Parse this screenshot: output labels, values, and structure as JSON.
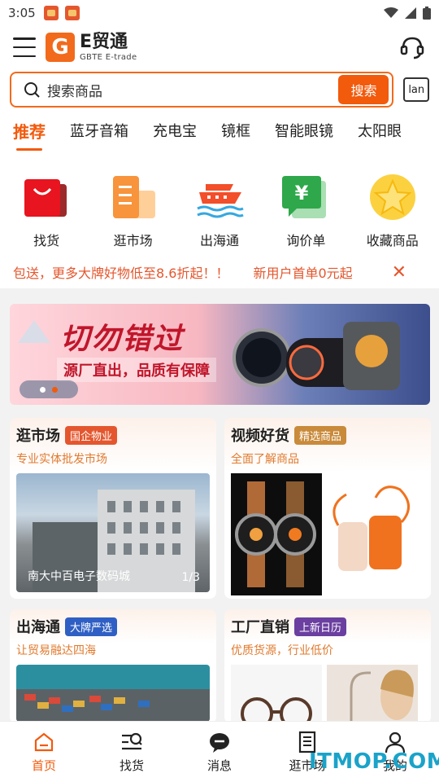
{
  "status": {
    "time": "3:05"
  },
  "header": {
    "logo_mark": "G",
    "logo_title": "E贸通",
    "logo_sub": "GBTE E-trade"
  },
  "search": {
    "placeholder": "搜索商品",
    "button": "搜索",
    "lang_button": "lan"
  },
  "tabs": [
    "推荐",
    "蓝牙音箱",
    "充电宝",
    "镜框",
    "智能眼镜",
    "太阳眼"
  ],
  "quick": [
    {
      "label": "找货",
      "icon": "shopping-bag-icon"
    },
    {
      "label": "逛市场",
      "icon": "building-icon"
    },
    {
      "label": "出海通",
      "icon": "ship-icon"
    },
    {
      "label": "询价单",
      "icon": "yen-quote-icon"
    },
    {
      "label": "收藏商品",
      "icon": "star-icon"
    }
  ],
  "ticker": {
    "text1": "包送，更多大牌好物低至8.6折起！！",
    "text2": "新用户首单0元起"
  },
  "banner": {
    "title": "切勿错过",
    "subtitle": "源厂直出，品质有保障"
  },
  "cards": [
    {
      "title": "逛市场",
      "badge": "国企物业",
      "badge_color": "#e4572e",
      "subtitle": "专业实体批发市场",
      "caption": "南大中百电子数码城",
      "page": "1/3"
    },
    {
      "title": "视频好货",
      "badge": "精选商品",
      "badge_color": "#c98a3a",
      "subtitle": "全面了解商品"
    },
    {
      "title": "出海通",
      "badge": "大牌严选",
      "badge_color": "#2f5fc4",
      "subtitle": "让贸易融达四海"
    },
    {
      "title": "工厂直销",
      "badge": "上新日历",
      "badge_color": "#6b3fa0",
      "subtitle": "优质货源，行业低价"
    }
  ],
  "nav": [
    {
      "label": "首页",
      "icon": "home-icon"
    },
    {
      "label": "找货",
      "icon": "search-list-icon"
    },
    {
      "label": "消息",
      "icon": "message-icon"
    },
    {
      "label": "逛市场",
      "icon": "building-icon"
    },
    {
      "label": "我的",
      "icon": "user-icon"
    }
  ],
  "watermark": "ITMOP.COM",
  "colors": {
    "accent": "#f25a0c"
  }
}
